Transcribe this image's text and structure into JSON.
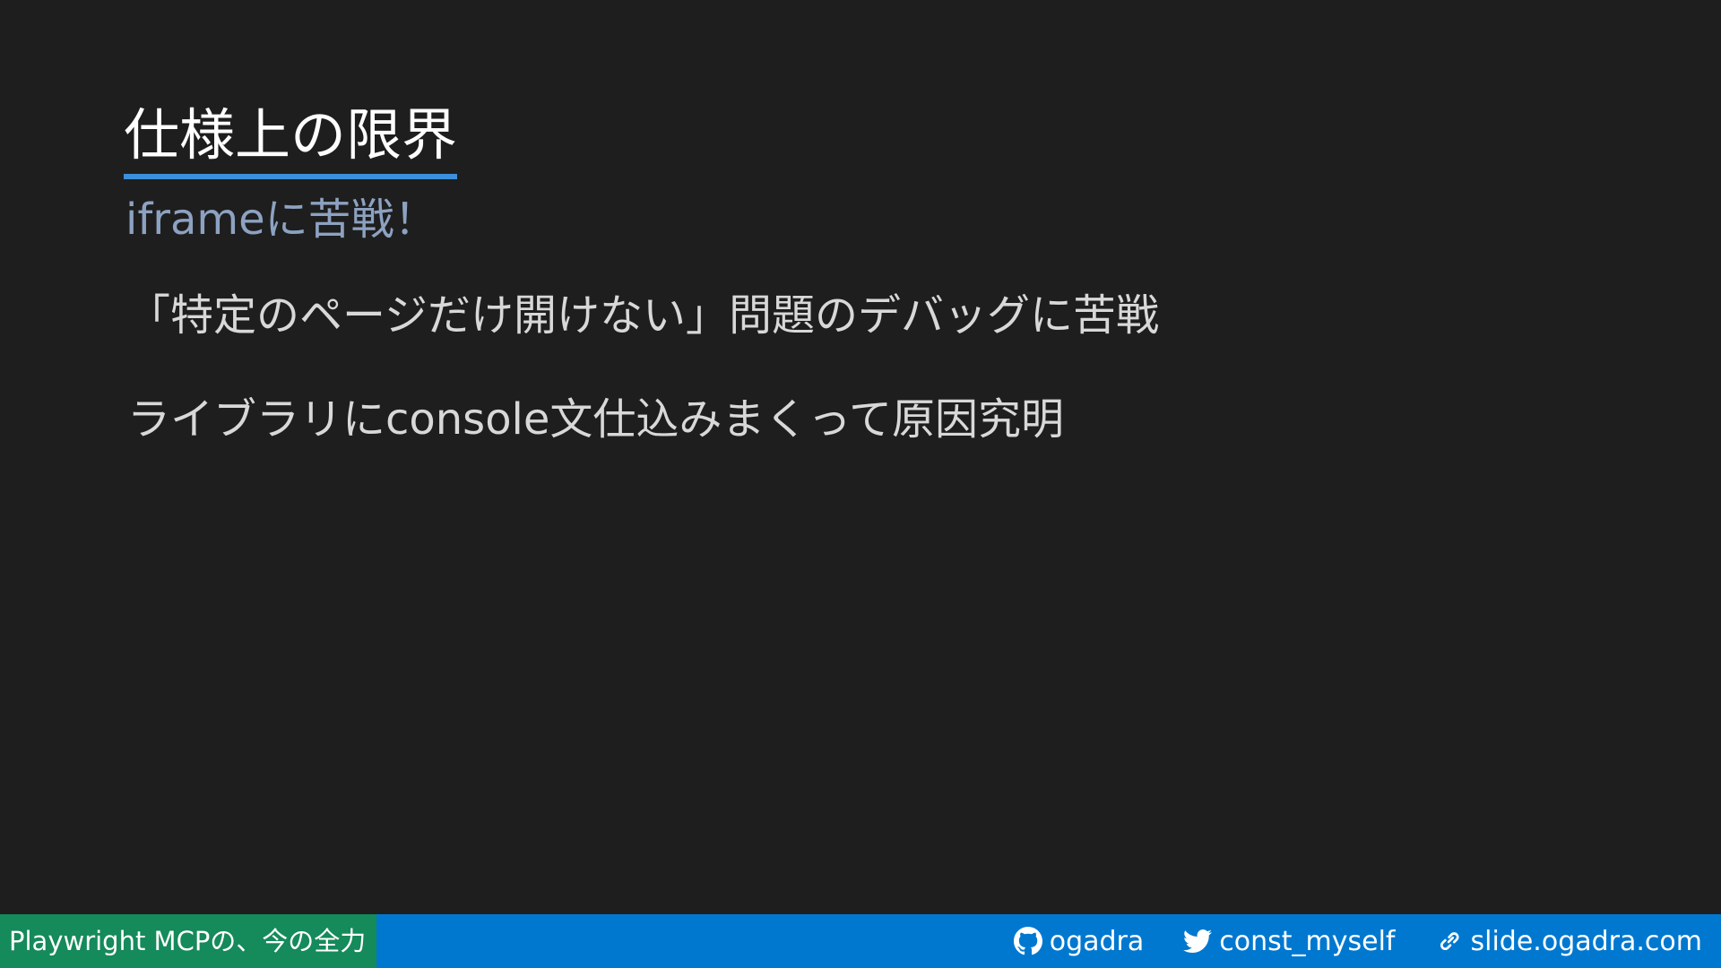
{
  "slide": {
    "title": "仕様上の限界",
    "subtitle": "iframeに苦戦！",
    "lines": [
      "「特定のページだけ開けない」問題のデバッグに苦戦",
      "ライブラリにconsole文仕込みまくって原因究明"
    ]
  },
  "footer": {
    "title": "Playwright MCPの、今の全力",
    "links": [
      {
        "icon": "github-icon",
        "label": "ogadra"
      },
      {
        "icon": "twitter-icon",
        "label": "const_myself"
      },
      {
        "icon": "link-icon",
        "label": "slide.ogadra.com"
      }
    ]
  },
  "colors": {
    "background": "#1e1e1e",
    "title_underline": "#3c8fdc",
    "subtitle": "#8da2c1",
    "footer_bar": "#0078d0",
    "footer_title_bg": "#158a5a"
  }
}
